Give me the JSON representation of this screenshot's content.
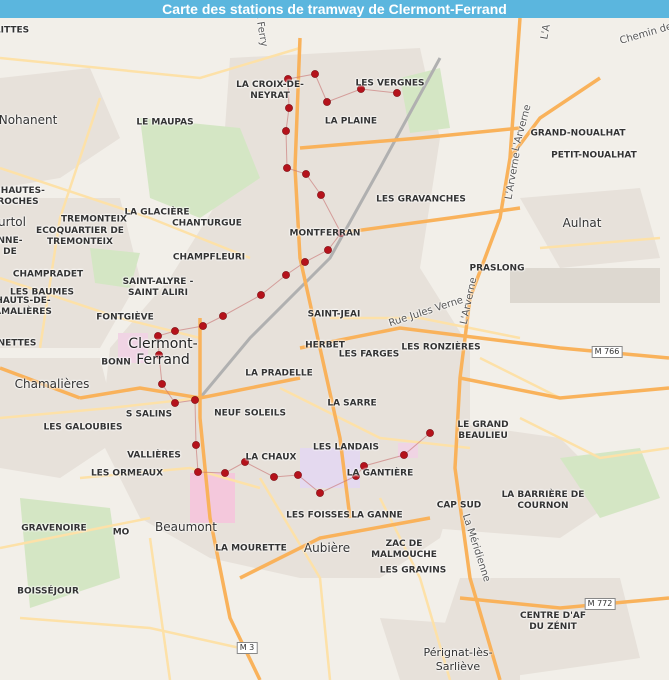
{
  "title": "Carte des stations de tramway de Clermont-Ferrand",
  "colors": {
    "title_bar": "#5bb6de",
    "station": "#b5121b",
    "background": "#f2efe9",
    "road_major": "#f9b25b",
    "road_minor": "#fde1a8",
    "urban": "#e7e1da",
    "park": "#d4e6c4"
  },
  "labels": {
    "villes": [
      {
        "id": "clermont-ferrand",
        "text": "Clermont-\nFerrand"
      },
      {
        "id": "chamalieres",
        "text": "Chamalières"
      },
      {
        "id": "beaumont",
        "text": "Beaumont"
      },
      {
        "id": "aubiere",
        "text": "Aubière"
      },
      {
        "id": "aulnat",
        "text": "Aulnat"
      },
      {
        "id": "nohanent",
        "text": "Nohanent"
      },
      {
        "id": "perignat",
        "text": "Pérignat-lès-\nSarliève"
      },
      {
        "id": "durtol",
        "text": "urtol"
      }
    ],
    "quartiers": [
      {
        "id": "littes",
        "text": "LITTES"
      },
      {
        "id": "croix-de-neyrat",
        "text": "LA CROIX-DE-\nNEYRAT"
      },
      {
        "id": "vergnes",
        "text": "LES VERGNES"
      },
      {
        "id": "maupas",
        "text": "LE MAUPAS"
      },
      {
        "id": "plaine",
        "text": "LA PLAINE"
      },
      {
        "id": "grand-noualhat",
        "text": "GRAND-NOUALHAT"
      },
      {
        "id": "petit-noualhat",
        "text": "PETIT-NOUALHAT"
      },
      {
        "id": "hautes-roches",
        "text": "S HAUTES-\nROCHES"
      },
      {
        "id": "gravanches",
        "text": "LES GRAVANCHES"
      },
      {
        "id": "glaciere",
        "text": "LA GLACIÈRE"
      },
      {
        "id": "tremonteix",
        "text": "TREMONTEIX"
      },
      {
        "id": "ecoquartier",
        "text": "ECOQUARTIER DE\nTREMONTEIX"
      },
      {
        "id": "chanturgue",
        "text": "CHANTURGUE"
      },
      {
        "id": "montferrand",
        "text": "MONTFERRAN"
      },
      {
        "id": "anne",
        "text": "NNE-\nDE"
      },
      {
        "id": "champfleuri",
        "text": "CHAMPFLEURI"
      },
      {
        "id": "champradet",
        "text": "CHAMPRADET"
      },
      {
        "id": "praslong",
        "text": "PRASLONG"
      },
      {
        "id": "saint-alyre",
        "text": "SAINT-ALYRE -\nSAINT ALIRI"
      },
      {
        "id": "baumes",
        "text": "LES BAUMES"
      },
      {
        "id": "hauts-de-chamalieres",
        "text": "HAUTS-DE-\nAMALIÈRES"
      },
      {
        "id": "saint-jean",
        "text": "SAINT-JEAI"
      },
      {
        "id": "fontgieve",
        "text": "FONTGIÈVE"
      },
      {
        "id": "nettes",
        "text": "NETTES"
      },
      {
        "id": "herbet",
        "text": "HERBET"
      },
      {
        "id": "farges",
        "text": "LES FARGES"
      },
      {
        "id": "ronzieres",
        "text": "LES RONZIÈRES"
      },
      {
        "id": "bonn",
        "text": "BONN"
      },
      {
        "id": "pradelle",
        "text": "LA PRADELLE"
      },
      {
        "id": "sarre",
        "text": "LA SARRE"
      },
      {
        "id": "salins",
        "text": "S SALINS"
      },
      {
        "id": "neuf-soleils",
        "text": "NEUF SOLEILS"
      },
      {
        "id": "galoubies",
        "text": "LES GALOUBIES"
      },
      {
        "id": "grand-beaulieu",
        "text": "LE GRAND\nBEAULIEU"
      },
      {
        "id": "landais",
        "text": "LES LANDAIS"
      },
      {
        "id": "vallieres",
        "text": "VALLIÈRES"
      },
      {
        "id": "chaux",
        "text": "LA CHAUX"
      },
      {
        "id": "gantiere",
        "text": "LA GANTIÈRE"
      },
      {
        "id": "ormeaux",
        "text": "LES ORMEAUX"
      },
      {
        "id": "cap-sud",
        "text": "CAP SUD"
      },
      {
        "id": "barriere-cournon",
        "text": "LA BARRIÈRE DE\nCOURNON"
      },
      {
        "id": "foisses",
        "text": "LES FOISSES"
      },
      {
        "id": "ganne",
        "text": "LA GANNE"
      },
      {
        "id": "gravenoire",
        "text": "GRAVENOIRE"
      },
      {
        "id": "mo",
        "text": "MO"
      },
      {
        "id": "mourette",
        "text": "LA MOURETTE"
      },
      {
        "id": "malmouche",
        "text": "ZAC DE\nMALMOUCHE"
      },
      {
        "id": "gravins",
        "text": "LES GRAVINS"
      },
      {
        "id": "boisseujour",
        "text": "BOISSÉJOUR"
      },
      {
        "id": "centre-affaires",
        "text": "CENTRE D'AF\nDU ZÉNIT"
      }
    ],
    "routes": [
      {
        "id": "rue-jules-verne",
        "text": "Rue Jules Verne"
      },
      {
        "id": "lavergne-1",
        "text": "L'Arverne"
      },
      {
        "id": "lavergne-2",
        "text": "L'Arverne"
      },
      {
        "id": "lavergne-3",
        "text": "L'Arverne"
      },
      {
        "id": "la-meridienne",
        "text": "La Méridienne"
      },
      {
        "id": "chemin",
        "text": "Chemin de"
      },
      {
        "id": "ferry",
        "text": "s Ferry"
      },
      {
        "id": "la-top",
        "text": "L'A"
      }
    ],
    "shields": [
      {
        "id": "m766",
        "text": "M 766"
      },
      {
        "id": "m772",
        "text": "M 772"
      },
      {
        "id": "m3",
        "text": "M 3"
      }
    ]
  },
  "stations_count": 32
}
